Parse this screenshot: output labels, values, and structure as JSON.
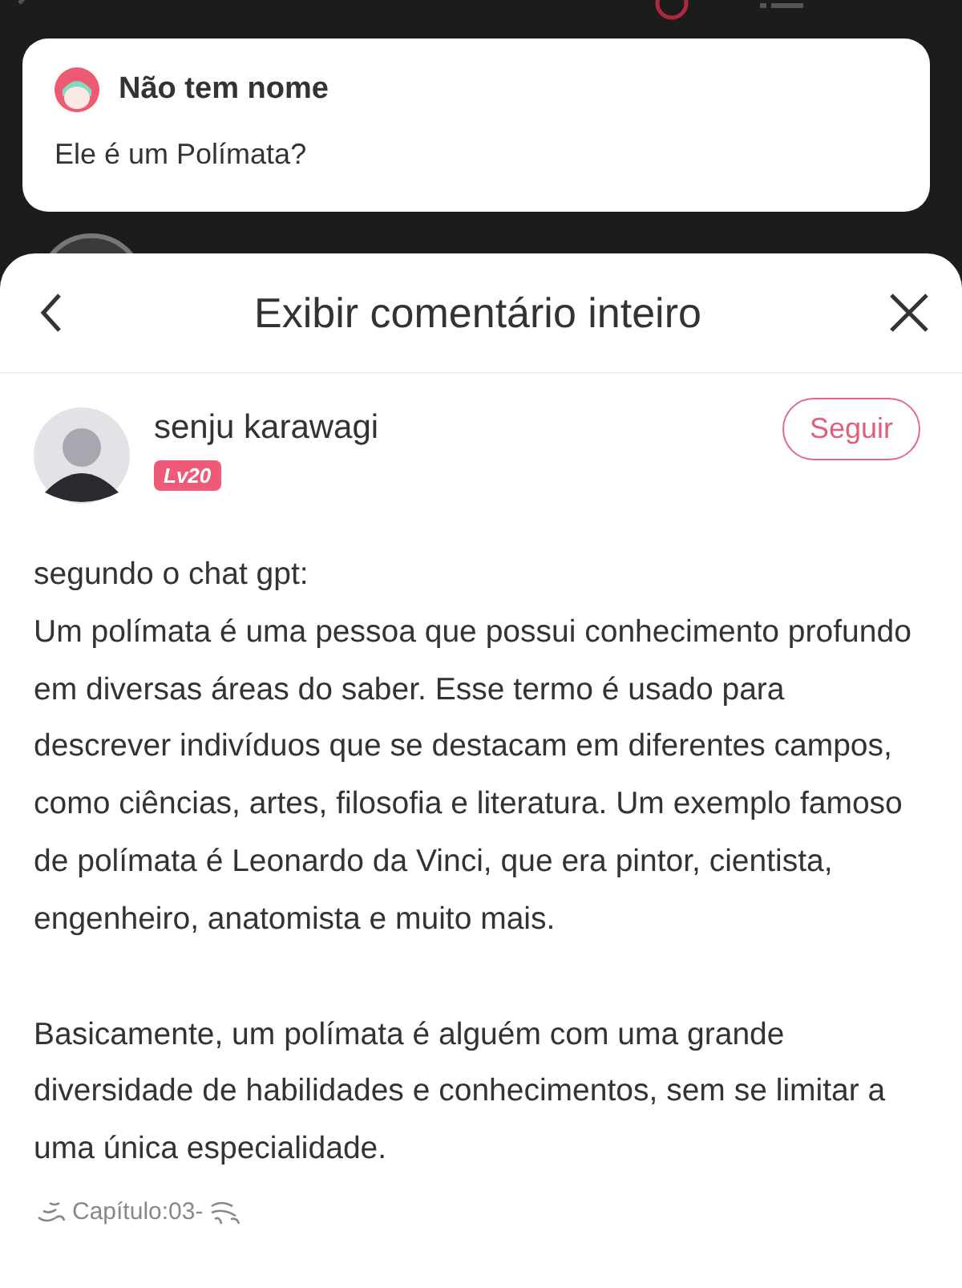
{
  "quoted_comment": {
    "author": "Não tem nome",
    "text": "Ele é um Polímata?"
  },
  "sheet": {
    "title": "Exibir comentário inteiro"
  },
  "comment": {
    "author": "senju karawagi",
    "level_badge": "Lv20",
    "follow_button": "Seguir",
    "paragraphs": [
      "segundo o chat gpt:\nUm polímata é uma pessoa que possui conhecimento profundo em diversas áreas do saber. Esse termo é usado para descrever indivíduos que se destacam em diferentes campos, como ciências, artes, filosofia e literatura. Um exemplo famoso de polímata é Leonardo da Vinci, que era pintor, cientista, engenheiro, anatomista e muito mais.",
      "Basicamente, um polímata é alguém com uma grande diversidade de habilidades e conhecimentos, sem se limitar a uma única especialidade."
    ],
    "chapter_tag": "Capítulo:03-"
  }
}
